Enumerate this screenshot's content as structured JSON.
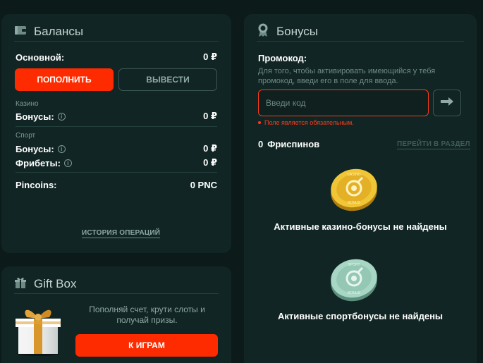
{
  "balances": {
    "title": "Балансы",
    "main_label": "Основной:",
    "main_value": "0 ₽",
    "deposit_label": "ПОПОЛНИТЬ",
    "withdraw_label": "ВЫВЕСТИ",
    "casino_section": "Казино",
    "casino_bonus_label": "Бонусы:",
    "casino_bonus_value": "0 ₽",
    "sport_section": "Спорт",
    "sport_bonus_label": "Бонусы:",
    "sport_bonus_value": "0 ₽",
    "freebets_label": "Фрибеты:",
    "freebets_value": "0 ₽",
    "pincoins_label": "Pincoins:",
    "pincoins_value": "0 PNC",
    "history_link": "ИСТОРИЯ ОПЕРАЦИЙ",
    "info_glyph": "i"
  },
  "giftbox": {
    "title": "Gift Box",
    "text_line1": "Пополняй счет, крути слоты и",
    "text_line2": "получай призы.",
    "play_label": "К ИГРАМ"
  },
  "bonuses": {
    "title": "Бонусы",
    "promo_label": "Промокод:",
    "promo_hint_line1": "Для того, чтобы активировать имеющийся у тебя",
    "promo_hint_line2": "промокод, введи его в поле для ввода.",
    "promo_placeholder": "Введи код",
    "promo_error": "Поле является обязательным.",
    "freespins_count": "0",
    "freespins_label": "Фриспинов",
    "go_to_section": "ПЕРЕЙТИ В РАЗДЕЛ",
    "casino_empty": "Активные казино-бонусы не найдены",
    "sport_empty": "Активные спортбонусы не найдены",
    "casino_coin_text": [
      "CASINO",
      "BONUS"
    ],
    "sport_coin_text": [
      "SPORT",
      "BONUS"
    ]
  },
  "colors": {
    "background": "#0c1b1a",
    "panel": "#112624",
    "accent_red": "#ff2b00",
    "error_red": "#ff3a1a",
    "muted_text": "#7e9894"
  },
  "icons": {
    "wallet": "wallet-icon",
    "award": "award-ribbon-icon",
    "gift": "gift-icon",
    "arrow": "arrow-right-icon",
    "info": "info-icon",
    "gift_box": "gift-box-image",
    "casino_coin": "casino-bonus-coin",
    "sport_coin": "sport-bonus-coin"
  }
}
